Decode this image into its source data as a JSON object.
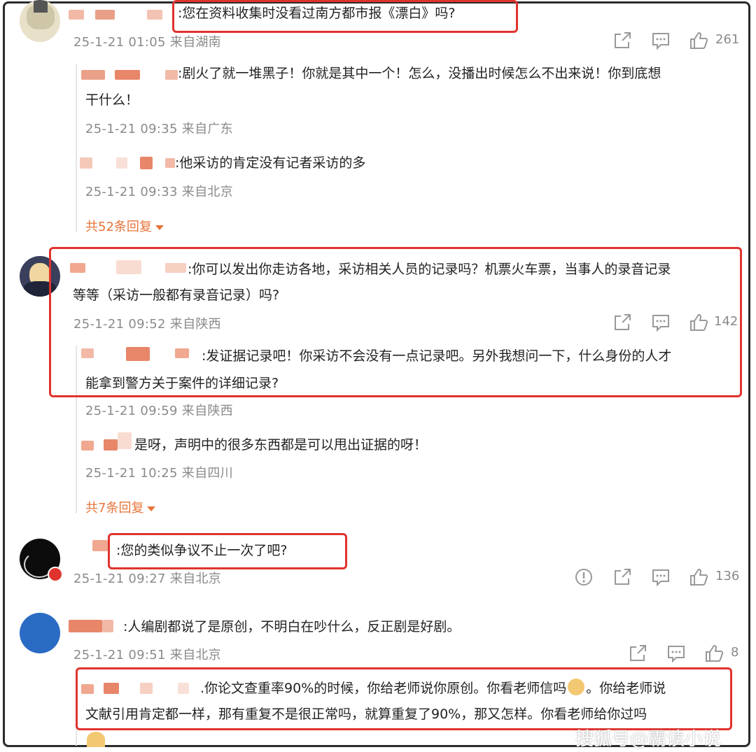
{
  "comments": [
    {
      "text": ":您在资料收集时没看过南方都市报《漂白》吗?",
      "time": "25-1-21 01:05 来自湖南",
      "likes": "261",
      "replies": [
        {
          "text": ":剧火了就一堆黑子！你就是其中一个！怎么，没播出时候怎么不出来说！你到底想",
          "text2": "干什么！",
          "time": "25-1-21 09:35 来自广东"
        },
        {
          "text": ":他采访的肯定没有记者采访的多",
          "time": "25-1-21 09:33 来自北京"
        }
      ],
      "more_replies": "共52条回复"
    },
    {
      "text": ":你可以发出你走访各地，采访相关人员的记录吗？机票火车票，当事人的录音记录",
      "text2": "等等（采访一般都有录音记录）吗?",
      "time": "25-1-21 09:52 来自陕西",
      "likes": "142",
      "replies": [
        {
          "text": ":发证据记录吧！你采访不会没有一点记录吧。另外我想问一下，什么身份的人才",
          "text2": "能拿到警方关于案件的详细记录?",
          "time": "25-1-21 09:59 来自陕西"
        },
        {
          "text": "是呀，声明中的很多东西都是可以甩出证据的呀！",
          "time": "25-1-21 10:25 来自四川"
        }
      ],
      "more_replies": "共7条回复"
    },
    {
      "text": ":您的类似争议不止一次了吧?",
      "time": "25-1-21 09:27 来自北京",
      "likes": "136"
    },
    {
      "text": ":人编剧都说了是原创，不明白在吵什么，反正剧是好剧。",
      "time": "25-1-21 09:51 来自北京",
      "likes": "8",
      "replies": [
        {
          "text": ".你论文查重率90%的时候，你给老师说你原创。你看老师信吗",
          "text_b": "。你给老师说",
          "text2": "文献引用肯定都一样，那有重复不是很正常吗，就算重复了90%，那又怎样。你看老师给你过吗"
        }
      ]
    }
  ],
  "watermark": "搜狐号@霸读小说",
  "icons": [
    "share-icon",
    "comment-icon",
    "like-icon",
    "report-icon",
    "doge-emoji-icon"
  ],
  "colors": {
    "highlight": "#e0332e",
    "link": "#e8743a",
    "meta": "#8a8a8a"
  }
}
